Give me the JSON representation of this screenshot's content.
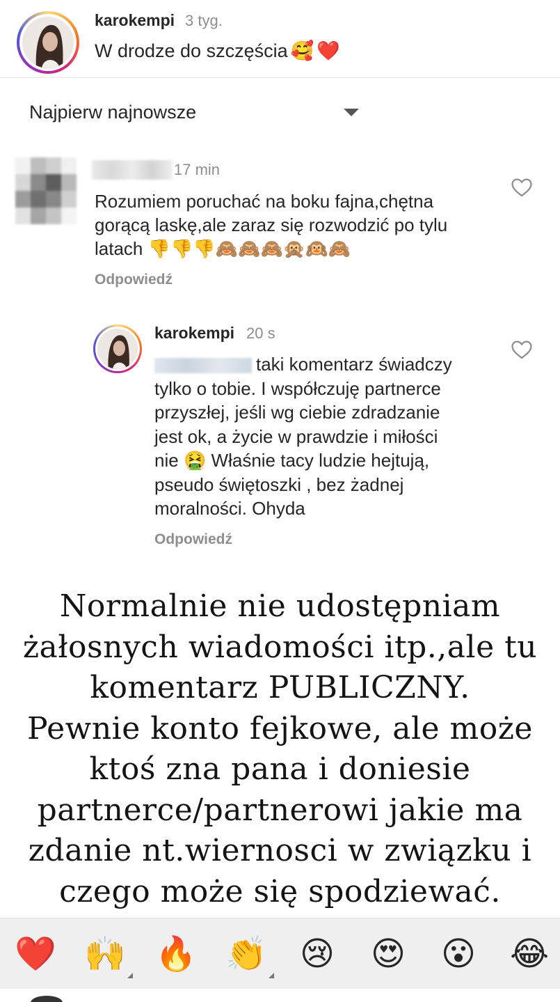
{
  "post": {
    "username": "karokempi",
    "time": "3 tyg.",
    "caption": "W drodze do szczęścia",
    "caption_emojis": [
      "🥰",
      "❤️"
    ]
  },
  "sort": {
    "label": "Najpierw najnowsze"
  },
  "comment": {
    "username_hidden": "",
    "time": "17 min",
    "text_line1": "Rozumiem poruchać na boku fajna,chętna",
    "text_line2": "gorącą laskę,ale zaraz się rozwodzić po tylu",
    "text_line3": "latach",
    "emojis": "👎👎👎🙈🙈🙈🙊🙉🙈",
    "reply_label": "Odpowiedź"
  },
  "reply": {
    "username": "karokempi",
    "time": "20 s",
    "line1": "taki komentarz świadczy",
    "line2": "tylko o tobie. I współczuję partnerce",
    "line3": "przyszłej, jeśli wg ciebie zdradzanie",
    "line4": "jest ok, a życie w prawdzie i miłości",
    "line5_pre": "nie",
    "line5_emoji": "🤮",
    "line5_post": "Właśnie tacy ludzie hejtują,",
    "line6": "pseudo świętoszki , bez żadnej",
    "line7": "moralności. Ohyda",
    "reply_label": "Odpowiedź"
  },
  "overlay": {
    "line1": "Normalnie nie udostępniam",
    "line2": "żałosnych wiadomości itp.,ale tu",
    "line3": "komentarz PUBLICZNY.",
    "line4": "Pewnie konto fejkowe, ale może",
    "line5": "ktoś zna pana i doniesie",
    "line6": "partnerce/partnerowi jakie ma",
    "line7": "zdanie nt.wiernosci w związku i",
    "line8": "czego może się spodziewać."
  },
  "reactions": [
    {
      "emoji": "❤️",
      "name": "heart"
    },
    {
      "emoji": "🙌",
      "name": "raised-hands"
    },
    {
      "emoji": "🔥",
      "name": "fire"
    },
    {
      "emoji": "👏",
      "name": "clapping-hands"
    },
    {
      "emoji": "😢",
      "name": "crying-face"
    },
    {
      "emoji": "😍",
      "name": "heart-eyes"
    },
    {
      "emoji": "😮",
      "name": "surprised-face"
    },
    {
      "emoji": "😂",
      "name": "tears-of-joy"
    }
  ],
  "icons": {
    "heart_outline": "heart-outline-icon",
    "sort_caret": "caret-down-icon"
  },
  "colors": {
    "text": "#262626",
    "muted": "#8e8e8e",
    "reaction_bar": "#efefef"
  }
}
